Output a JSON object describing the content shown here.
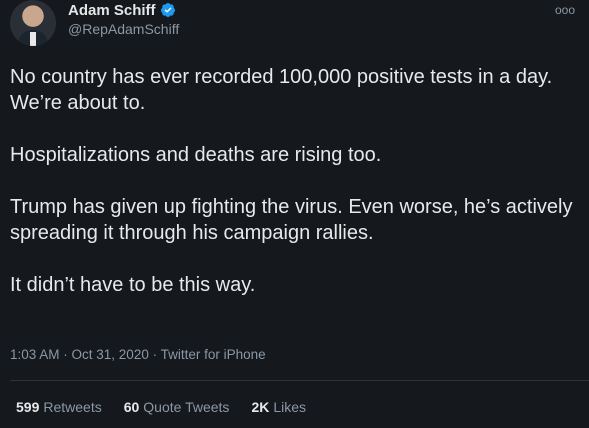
{
  "author": {
    "display_name": "Adam Schiff",
    "handle": "@RepAdamSchiff",
    "verified_icon": "verified-badge-icon",
    "avatar": "avatar-photo"
  },
  "more_menu": "ooo",
  "tweet": {
    "paragraphs": [
      "No country has ever recorded 100,000 positive tests in a day. We’re about to.",
      "Hospitalizations and deaths are rising too.",
      "Trump has given up fighting the virus. Even worse, he’s actively spreading it through his campaign rallies.",
      "It didn’t have to be this way."
    ]
  },
  "meta": {
    "time": "1:03 AM",
    "date": "Oct 31, 2020",
    "source": "Twitter for iPhone",
    "separator": " · "
  },
  "stats": {
    "retweets_count": "599",
    "retweets_label": "Retweets",
    "quotes_count": "60",
    "quotes_label": "Quote Tweets",
    "likes_count": "2K",
    "likes_label": "Likes"
  },
  "colors": {
    "background": "#15181c",
    "text": "#e7e9ea",
    "muted": "#8b98a5",
    "verified": "#1d9bf0",
    "divider": "#2f3336"
  }
}
